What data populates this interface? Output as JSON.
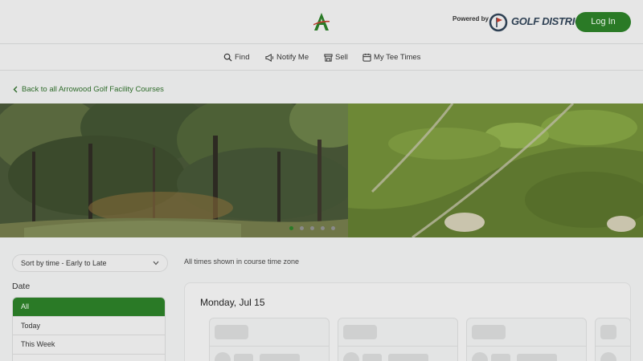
{
  "header": {
    "powered_label": "Powered by",
    "brand_name": "GOLF DISTRICT",
    "login_label": "Log In",
    "brand_color": "#2a7a26",
    "brand_dark": "#2f4154"
  },
  "nav": {
    "items": [
      {
        "label": "Find",
        "icon": "search-icon"
      },
      {
        "label": "Notify Me",
        "icon": "megaphone-icon"
      },
      {
        "label": "Sell",
        "icon": "store-icon"
      },
      {
        "label": "My Tee Times",
        "icon": "calendar-icon"
      }
    ]
  },
  "back_link": {
    "label": "Back to all Arrowood Golf Facility Courses"
  },
  "carousel": {
    "dot_count": 5,
    "active_index": 0
  },
  "filters": {
    "sort_value": "Sort by time - Early to Late",
    "timezone_note": "All times shown in course time zone",
    "date_label": "Date",
    "date_options": [
      "All",
      "Today",
      "This Week"
    ]
  },
  "results": {
    "day_title": "Monday, Jul 15"
  }
}
